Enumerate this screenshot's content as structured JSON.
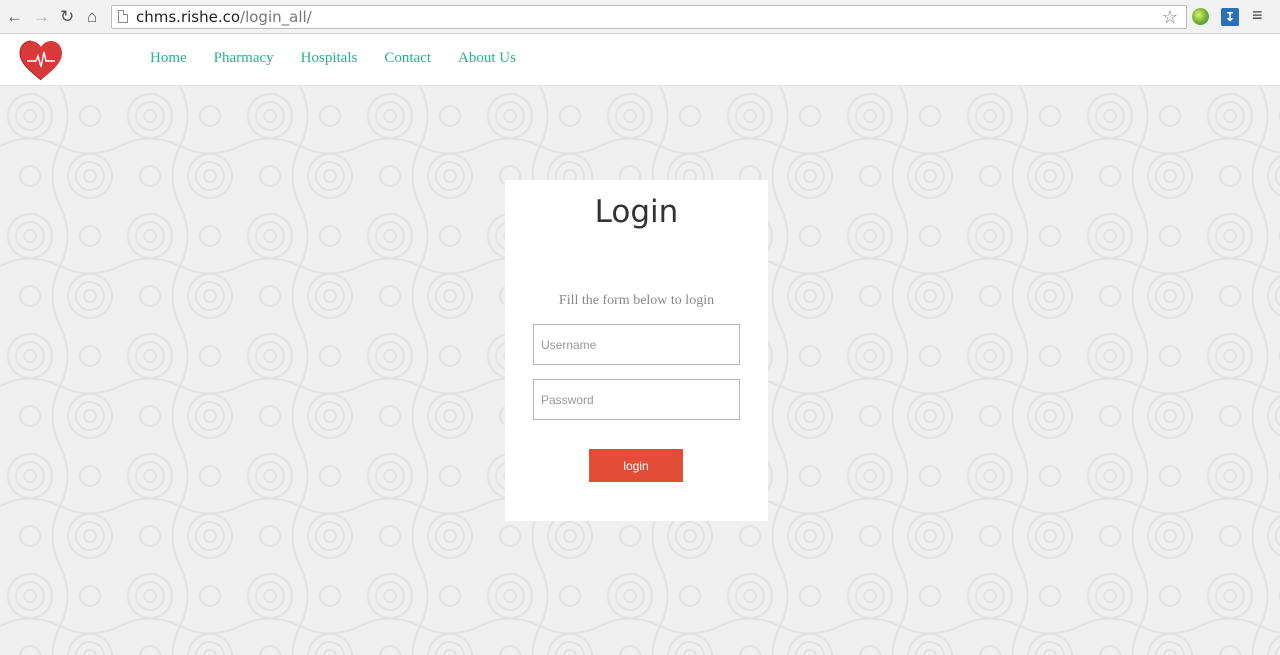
{
  "browser": {
    "url_host": "chms.rishe.co",
    "url_path": "/login_all/",
    "icons": [
      "back-arrow-icon",
      "forward-arrow-icon",
      "reload-icon",
      "home-icon",
      "page-icon",
      "star-icon",
      "globe-extension-icon",
      "download-extension-icon",
      "menu-icon"
    ]
  },
  "header": {
    "logo": "heart-pulse-logo",
    "nav": [
      "Home",
      "Pharmacy",
      "Hospitals",
      "Contact",
      "About Us"
    ]
  },
  "login": {
    "title": "Login",
    "subtitle": "Fill the form below to login",
    "username_placeholder": "Username",
    "password_placeholder": "Password",
    "button_label": "login"
  },
  "colors": {
    "accent_nav": "#2bb08f",
    "button": "#e44c3a",
    "logo_red": "#d83a3a",
    "background": "#f0f0f0"
  }
}
